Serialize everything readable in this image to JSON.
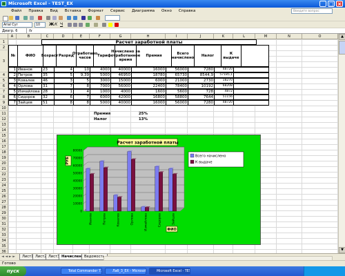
{
  "window": {
    "title": "Microsoft Excel - TEST_EX"
  },
  "menu": [
    "Файл",
    "Правка",
    "Вид",
    "Вставка",
    "Формат",
    "Сервис",
    "Диаграмма",
    "Окно",
    "Справка"
  ],
  "help_placeholder": "Введите вопрос",
  "toolbar": {
    "font": "Arial Cyr",
    "size": "10"
  },
  "formula": {
    "name_box": "Диагр. 6",
    "fx": "fx"
  },
  "columns": [
    "A",
    "B",
    "C",
    "D",
    "E",
    "F",
    "G",
    "H",
    "I",
    "J",
    "K",
    "L",
    "M",
    "N",
    "O"
  ],
  "rows": [
    "1",
    "2",
    "3",
    "4",
    "5",
    "6",
    "7",
    "8",
    "9",
    "10",
    "11",
    "12",
    "13",
    "14",
    "15",
    "16",
    "17",
    "18",
    "19",
    "20",
    "21",
    "22",
    "23",
    "24",
    "25",
    "26",
    "27",
    "28",
    "29",
    "30",
    "31",
    "32",
    "33",
    "34",
    "35",
    "36",
    "37"
  ],
  "sheet": {
    "table_title": "Расчет заработной платы",
    "headers": [
      "№",
      "ФИО",
      "Возраст",
      "Разряд",
      "Отработано часов",
      "Тариф",
      "Начислено за отработанное время",
      "Премия",
      "Всего начислено",
      "Налог",
      "К выдаче"
    ],
    "data": [
      [
        "1",
        "Иванов",
        "23",
        "4",
        "10",
        "4000",
        "40000",
        "16000",
        "56000",
        "7280",
        "48720"
      ],
      [
        "2",
        "Петров",
        "35",
        "5",
        "9,39",
        "5000",
        "46950",
        "18780",
        "65730",
        "8544,9",
        "57185,1"
      ],
      [
        "3",
        "Ковалев",
        "46",
        "3",
        "5",
        "3000",
        "15000",
        "6000",
        "21000",
        "2730",
        "18270"
      ],
      [
        "4",
        "Орлова",
        "31",
        "7",
        "8",
        "7000",
        "56000",
        "22400",
        "78400",
        "10192",
        "68208"
      ],
      [
        "5",
        "Измайлова",
        "28",
        "1",
        "4",
        "1000",
        "4000",
        "1600",
        "5600",
        "728",
        "4872"
      ],
      [
        "6",
        "Сидоров",
        "32",
        "6",
        "7",
        "6000",
        "42000",
        "16800",
        "58800",
        "7644",
        "51156"
      ],
      [
        "7",
        "Зайцев",
        "51",
        "8",
        "8",
        "5000",
        "40000",
        "16000",
        "56000",
        "7280",
        "48720"
      ]
    ],
    "params": [
      {
        "label": "Премия",
        "value": "25%"
      },
      {
        "label": "Налог",
        "value": "13%"
      }
    ]
  },
  "chart_data": {
    "type": "bar",
    "title": "Расчет заработной платы",
    "xlabel": "ФИО",
    "ylabel": "РУБ",
    "categories": [
      "Иванов",
      "Петров",
      "Ковалев",
      "Орлова",
      "Измайлова",
      "Сидоров",
      "Зайцев"
    ],
    "series": [
      {
        "name": "Всего начислено",
        "values": [
          56000,
          65730,
          21000,
          78400,
          5600,
          58800,
          56000
        ],
        "color": "#7b7bf0"
      },
      {
        "name": "К выдаче",
        "values": [
          48720,
          57185.1,
          18270,
          68208,
          4872,
          51156,
          48720
        ],
        "color": "#7a1040"
      }
    ],
    "ylim": [
      0,
      80000
    ],
    "yticks": [
      "0",
      "10000",
      "20000",
      "30000",
      "40000",
      "50000",
      "60000",
      "70000",
      "80000"
    ],
    "grid": true,
    "legend": "right",
    "plot_bg": "#c0c0c0",
    "chart_bg": "#00dd00"
  },
  "tabs": [
    "Лист1",
    "Лист2",
    "Лист3",
    "Начисление",
    "Ведомость"
  ],
  "active_tab": "Начисление",
  "status": "Готово",
  "taskbar": {
    "start": "пуск",
    "items": [
      "Total Commander 7.0...",
      "Лаб_3_EX - Microsoft...",
      "Microsoft Excel - TES..."
    ],
    "clock": ""
  }
}
